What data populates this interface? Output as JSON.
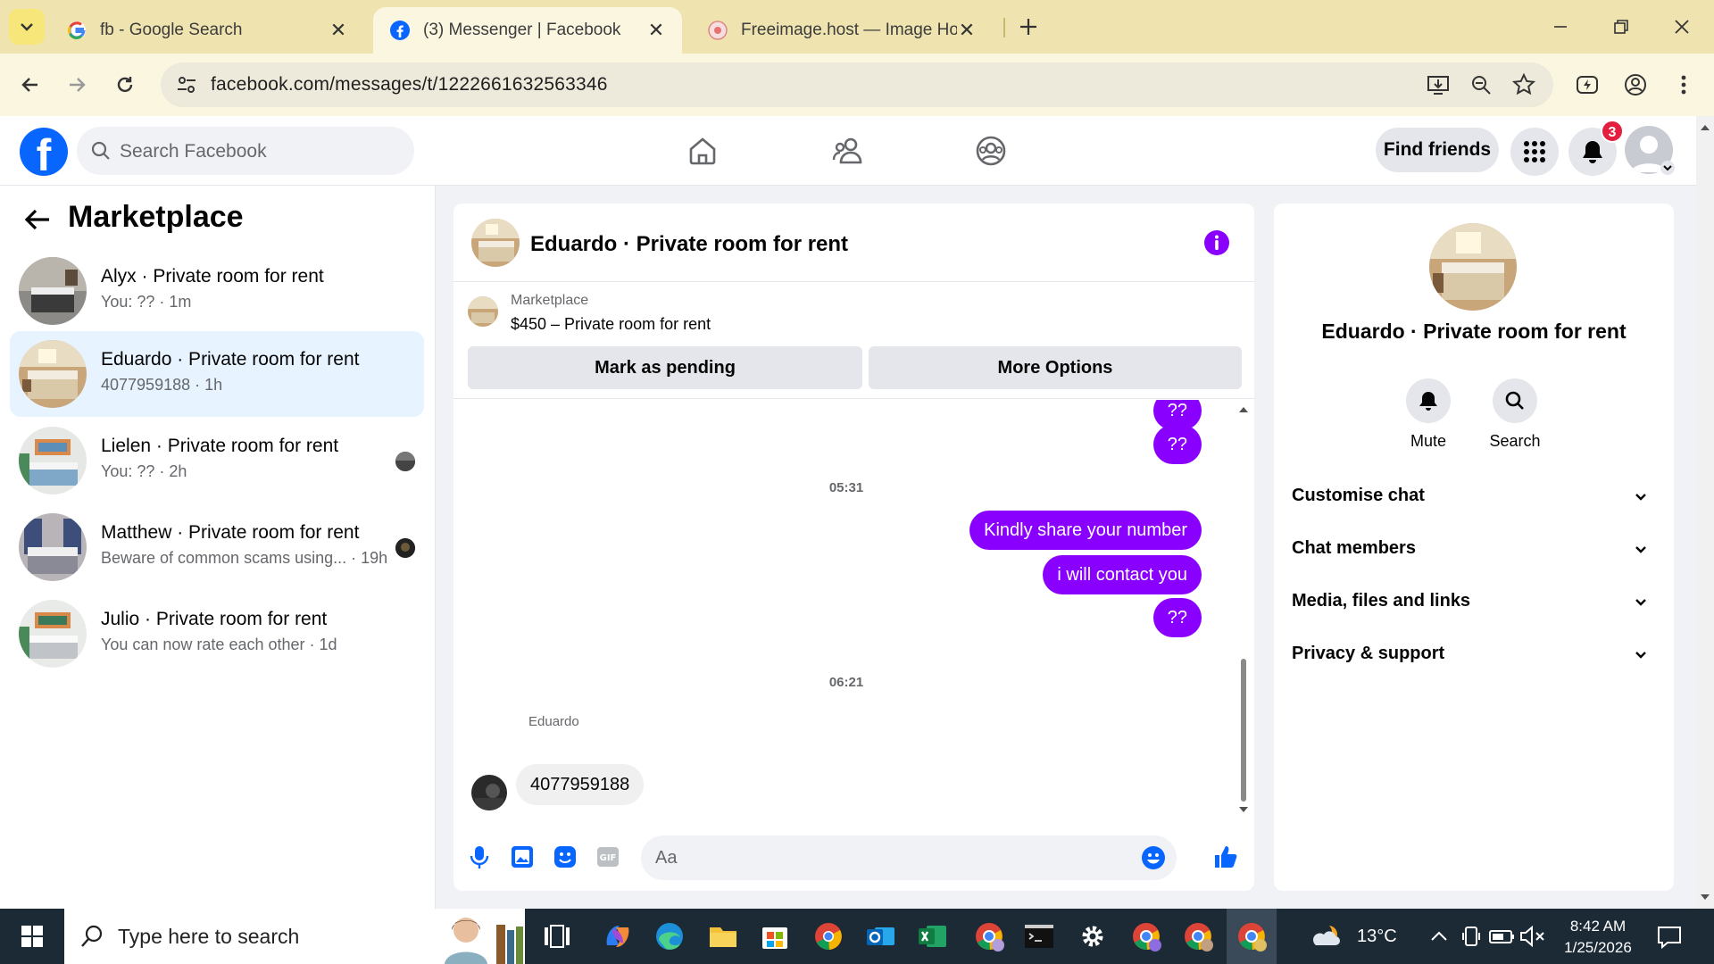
{
  "browser": {
    "tabs": [
      {
        "title": "fb - Google Search",
        "icon": "google-icon",
        "active": false
      },
      {
        "title": "(3) Messenger | Facebook",
        "icon": "facebook-icon",
        "active": true
      },
      {
        "title": "Freeimage.host — Image Hostin",
        "icon": "freeimage-icon",
        "active": false
      }
    ],
    "url": "facebook.com/messages/t/1222661632563346"
  },
  "fb_header": {
    "logo": "f",
    "search_placeholder": "Search Facebook",
    "find_friends": "Find friends",
    "notification_count": "3"
  },
  "sidebar": {
    "title": "Marketplace",
    "conversations": [
      {
        "name": "Alyx · Private room for rent",
        "preview": "You: ?? · 1m",
        "selected": false
      },
      {
        "name": "Eduardo · Private room for rent",
        "preview": "4077959188 · 1h",
        "selected": true
      },
      {
        "name": "Lielen · Private room for rent",
        "preview": "You: ?? · 2h",
        "selected": false
      },
      {
        "name": "Matthew · Private room for rent",
        "preview": "Beware of common scams using... · 19h",
        "selected": false
      },
      {
        "name": "Julio · Private room for rent",
        "preview": "You can now rate each other · 1d",
        "selected": false
      }
    ]
  },
  "chat": {
    "title": "Eduardo · Private room for rent",
    "marketplace_label": "Marketplace",
    "listing": "$450 – Private room for rent",
    "mark_pending": "Mark as pending",
    "more_options": "More Options",
    "messages": {
      "top1": "??",
      "top2": "??",
      "time1": "05:31",
      "m1": "Kindly share your number",
      "m2": "i will contact you",
      "m3": "??",
      "time2": "06:21",
      "sender": "Eduardo",
      "reply": "4077959188"
    },
    "input_placeholder": "Aa"
  },
  "details": {
    "title": "Eduardo · Private room for rent",
    "mute": "Mute",
    "search": "Search",
    "sections": [
      "Customise chat",
      "Chat members",
      "Media, files and links",
      "Privacy & support"
    ]
  },
  "taskbar": {
    "search_placeholder": "Type here to search",
    "temperature": "13°C",
    "time": "8:42 AM",
    "date": "1/25/2026"
  },
  "colors": {
    "fb_blue": "#0866ff",
    "bubble_purple": "#8a00ff",
    "tab_strip": "#efe4b0",
    "taskbar": "#1c2a36"
  }
}
